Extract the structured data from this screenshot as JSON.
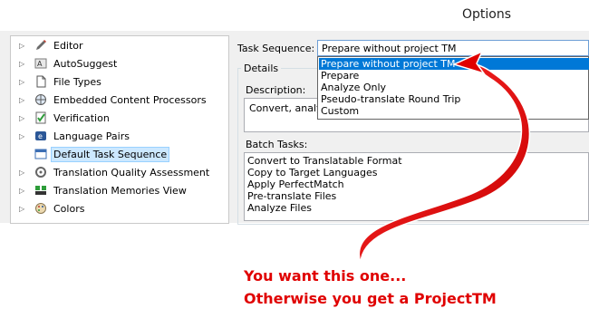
{
  "window": {
    "title": "Options"
  },
  "tree": {
    "items": [
      {
        "label": "Editor",
        "icon": "pencil-icon",
        "selected": false,
        "expandable": true
      },
      {
        "label": "AutoSuggest",
        "icon": "autosuggest-icon",
        "selected": false,
        "expandable": true
      },
      {
        "label": "File Types",
        "icon": "file-types-icon",
        "selected": false,
        "expandable": true
      },
      {
        "label": "Embedded Content Processors",
        "icon": "globe-icon",
        "selected": false,
        "expandable": true
      },
      {
        "label": "Verification",
        "icon": "verification-icon",
        "selected": false,
        "expandable": true
      },
      {
        "label": "Language Pairs",
        "icon": "language-pairs-icon",
        "selected": false,
        "expandable": true
      },
      {
        "label": "Default Task Sequence",
        "icon": "task-sequence-icon",
        "selected": true,
        "expandable": false
      },
      {
        "label": "Translation Quality Assessment",
        "icon": "tqa-icon",
        "selected": false,
        "expandable": true
      },
      {
        "label": "Translation Memories View",
        "icon": "tm-view-icon",
        "selected": false,
        "expandable": true
      },
      {
        "label": "Colors",
        "icon": "palette-icon",
        "selected": false,
        "expandable": true
      }
    ]
  },
  "task_sequence": {
    "label": "Task Sequence:",
    "selected": "Prepare without project TM",
    "options": [
      "Prepare without project TM",
      "Prepare",
      "Analyze Only",
      "Pseudo-translate Round Trip",
      "Custom"
    ],
    "highlighted_index": 0
  },
  "details": {
    "caption": "Details",
    "description_label": "Description:",
    "description_text": "Convert, analyz",
    "batch_label": "Batch Tasks:",
    "batch_tasks": [
      "Convert to Translatable Format",
      "Copy to Target Languages",
      "Apply PerfectMatch",
      "Pre-translate Files",
      "Analyze Files"
    ]
  },
  "annotation": {
    "line1": "You want this one...",
    "line2": "Otherwise you get a ProjectTM",
    "color": "#e00000"
  }
}
